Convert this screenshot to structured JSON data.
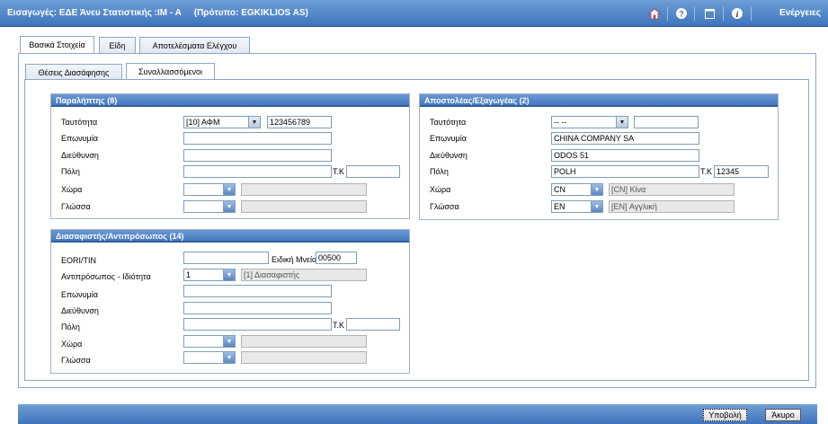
{
  "header": {
    "title": "Εισαγωγές: ΕΔΕ Άνευ Στατιστικής :IM - A",
    "template": "(Πρότυπο: EGKIKLIOS AS)",
    "actions_label": "Ενέργειες",
    "icons": [
      "home-icon",
      "help-icon",
      "window-icon",
      "info-icon"
    ]
  },
  "tabs": [
    "Βασικά Στοιχεία",
    "Είδη",
    "Αποτελέσματα Ελέγχου"
  ],
  "subtabs": [
    "Θέσεις Διασάφησης",
    "Συναλλασσόμενοι"
  ],
  "consignee": {
    "title": "Παραλήπτης (8)",
    "labels": {
      "identity": "Ταυτότητα",
      "surname": "Επωνυμία",
      "address": "Διεύθυνση",
      "city": "Πόλη",
      "postcode": "Τ.Κ",
      "country": "Χώρα",
      "language": "Γλώσσα"
    },
    "values": {
      "identity_type": "[10] ΑΦΜ",
      "identity_number": "123456789",
      "surname": "",
      "address": "",
      "city": "",
      "postcode": "",
      "country": "",
      "country_desc": "",
      "language": "",
      "language_desc": ""
    }
  },
  "consignor": {
    "title": "Αποστολέας/Εξαγωγέας (2)",
    "labels": {
      "identity": "Ταυτότητα",
      "surname": "Επωνυμία",
      "address": "Διεύθυνση",
      "city": "Πόλη",
      "postcode": "Τ.Κ",
      "country": "Χώρα",
      "language": "Γλώσσα"
    },
    "values": {
      "identity_type": "-- --",
      "identity_number": "",
      "surname": "CHINA COMPANY SA",
      "address": "ODOS 51",
      "city": "POLH",
      "postcode": "12345",
      "country": "CN",
      "country_desc": "[CN] Κίνα",
      "language": "EN",
      "language_desc": "[EN] Αγγλική"
    }
  },
  "declarant": {
    "title": "Διασαφιστής/Αντιπρόσωπος (14)",
    "labels": {
      "eori": "EORI/TIN",
      "special_mention": "Ειδική Μνεία",
      "representative": "Αντιπρόσωπος - Ιδιότητα",
      "surname": "Επωνυμία",
      "address": "Διεύθυνση",
      "city": "Πόλη",
      "postcode": "Τ.Κ",
      "country": "Χώρα",
      "language": "Γλώσσα"
    },
    "values": {
      "eori": "",
      "special_mention": "00500",
      "representative": "1",
      "representative_desc": "[1] Διασαφιστής",
      "surname": "",
      "address": "",
      "city": "",
      "postcode": "",
      "country": "",
      "country_desc": "",
      "language": "",
      "language_desc": ""
    }
  },
  "buttons": {
    "submit": "Υποβολή",
    "cancel": "Άκυρο"
  }
}
